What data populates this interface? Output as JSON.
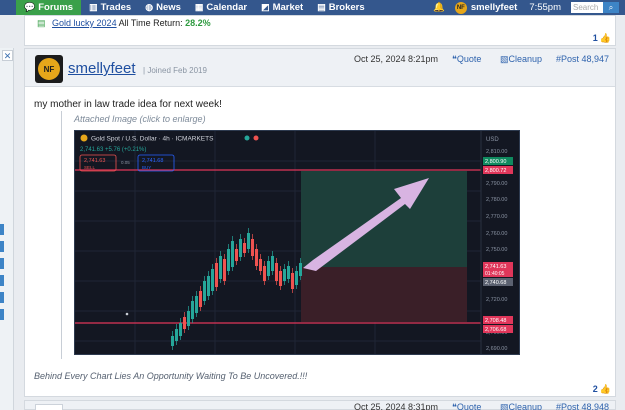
{
  "nav": {
    "items": [
      {
        "label": "Forums",
        "icon": "chat-bubbles-icon"
      },
      {
        "label": "Trades",
        "icon": "bar-chart-icon"
      },
      {
        "label": "News",
        "icon": "globe-icon"
      },
      {
        "label": "Calendar",
        "icon": "calendar-icon"
      },
      {
        "label": "Market",
        "icon": "market-chart-icon"
      },
      {
        "label": "Brokers",
        "icon": "building-icon"
      }
    ],
    "username": "smellyfeet",
    "time": "7:55pm",
    "search_placeholder": "Search"
  },
  "prev_post": {
    "link": "Gold lucky 2024",
    "return_label": "All Time Return:",
    "return_value": "28.2%",
    "likes": "1"
  },
  "post": {
    "avatar_text": "NF",
    "username": "smellyfeet",
    "joined": "Joined Feb 2019",
    "date": "Oct 25, 2024 8:21pm",
    "quote_label": "Quote",
    "cleanup_label": "Cleanup",
    "post_number": "Post 48,947",
    "body": "my mother in law trade idea for next week!",
    "attachment_label": "Attached Image (click to enlarge)",
    "signature": "Behind Every Chart Lies An Opportunity Waiting To Be Uncovered.!!!",
    "likes": "2"
  },
  "chart": {
    "symbol": "Gold Spot / U.S. Dollar · 4h · ICMARKETS",
    "quote_line": "2,741.63 +5.76 (+0.21%)",
    "sell_price": "2,741.63",
    "sell_label": "SELL",
    "spread": "0.05",
    "buy_price": "2,741.68",
    "buy_label": "BUY",
    "currency": "USD",
    "axis_ticks": [
      "2,810.00",
      "2,790.00",
      "2,780.00",
      "2,770.00",
      "2,760.00",
      "2,750.00",
      "2,730.00",
      "2,720.00",
      "2,700.00",
      "2,690.00"
    ],
    "labels": {
      "top_green": "2,800.90",
      "top_red": "2,800.72",
      "current_price": "2,741.63",
      "current_countdown": "01:40:05",
      "entry": "2,740.68",
      "stop_1": "2,708.48",
      "stop_2": "2,706.68"
    },
    "colors": {
      "background": "#131722",
      "bull": "#26a69a",
      "bear": "#ef5350",
      "arrow": "#d8b4e2"
    }
  },
  "next_post": {
    "date": "Oct 25, 2024 8:31pm",
    "quote_label": "Quote",
    "cleanup_label": "Cleanup",
    "post_number": "Post 48,948"
  }
}
